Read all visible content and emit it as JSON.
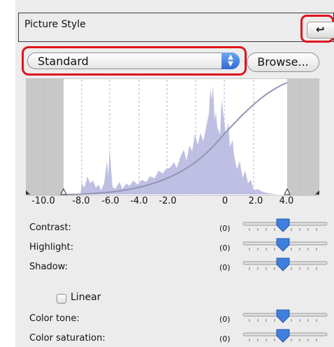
{
  "panel": {
    "title": "Picture Style",
    "reset_icon": "undo-arrow-icon"
  },
  "style_select": {
    "selected": "Standard",
    "arrows_icon": "updown-arrows-icon"
  },
  "browse_label": "Browse...",
  "histogram": {
    "tick_labels": [
      "-10.0",
      "-8.0",
      "-6.0",
      "-4.0",
      "-2.0",
      "0",
      "2.0",
      "4.0"
    ]
  },
  "sliders": [
    {
      "label": "Contrast:",
      "value": "(0)"
    },
    {
      "label": "Highlight:",
      "value": "(0)"
    },
    {
      "label": "Shadow:",
      "value": "(0)"
    },
    {
      "label": "Color tone:",
      "value": "(0)"
    },
    {
      "label": "Color saturation:",
      "value": "(0)"
    }
  ],
  "linear": {
    "label": "Linear",
    "checked": false
  },
  "colors": {
    "highlight_frame": "#e0141e",
    "histogram_fill": "#b8b8e0",
    "thumb": "#3f7fe0"
  }
}
